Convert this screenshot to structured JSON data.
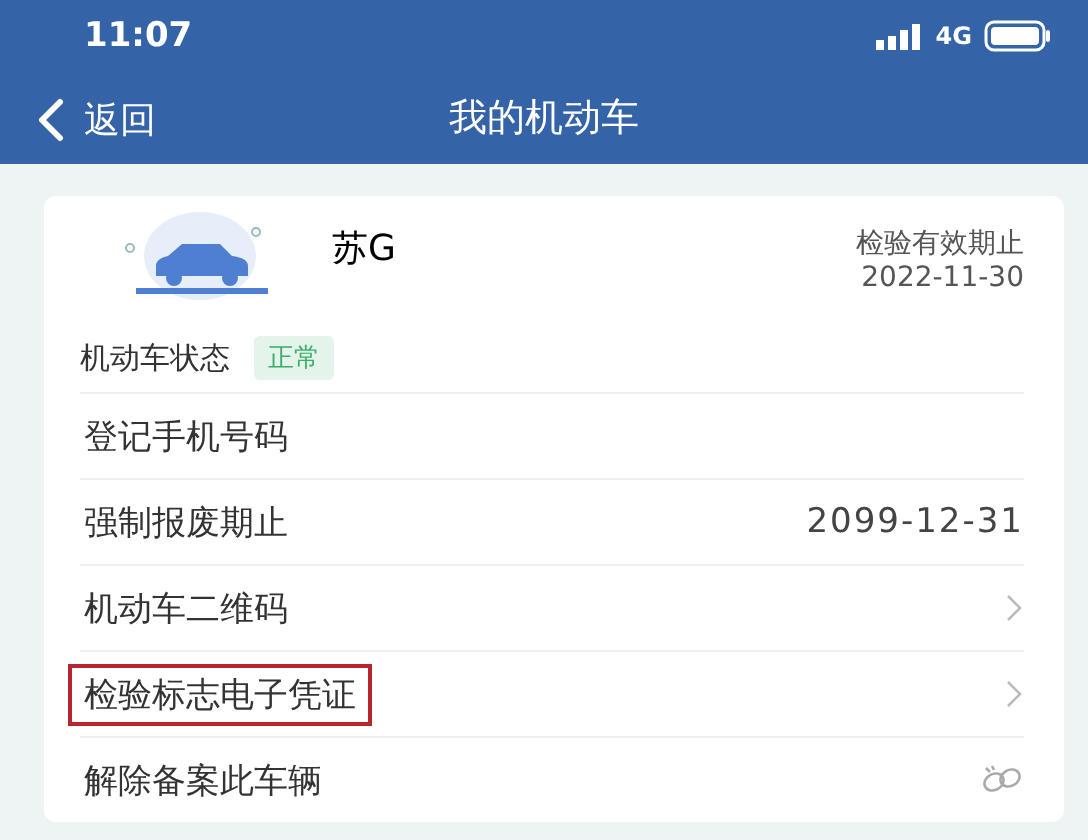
{
  "status_bar": {
    "time": "11:07",
    "network": "4G"
  },
  "nav": {
    "back": "返回",
    "title": "我的机动车"
  },
  "vehicle": {
    "plate": "苏G",
    "expiry_label": "检验有效期止",
    "expiry_date": "2022-11-30"
  },
  "vehicle_status": {
    "label": "机动车状态",
    "badge": "正常",
    "color": "#3cae6a"
  },
  "rows": [
    {
      "kind": "plain",
      "label": "登记手机号码",
      "highlighted": false
    },
    {
      "kind": "value",
      "label": "强制报废期止",
      "value": "2099-12-31",
      "highlighted": false
    },
    {
      "kind": "link",
      "label": "机动车二维码",
      "highlighted": false
    },
    {
      "kind": "link",
      "label": "检验标志电子凭证",
      "highlighted": true
    },
    {
      "kind": "unlink",
      "label": "解除备案此车辆",
      "highlighted": false
    }
  ]
}
